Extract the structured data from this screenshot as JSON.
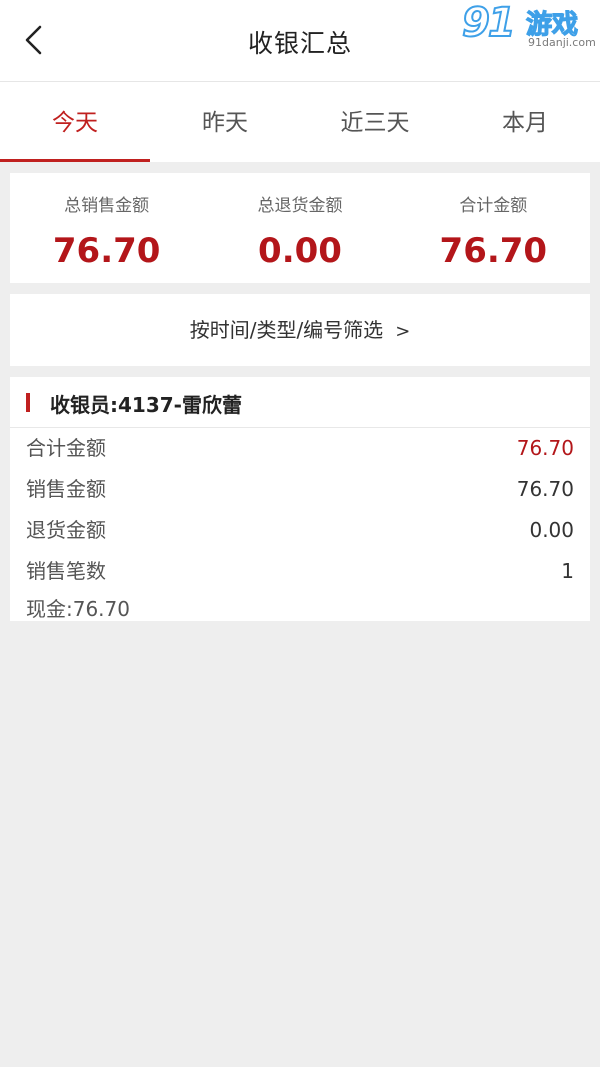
{
  "header": {
    "title": "收银汇总"
  },
  "watermark": {
    "brand_num": "91",
    "brand_text": "游戏",
    "url": "91danji.com"
  },
  "tabs": [
    {
      "label": "今天",
      "active": true
    },
    {
      "label": "昨天",
      "active": false
    },
    {
      "label": "近三天",
      "active": false
    },
    {
      "label": "本月",
      "active": false
    }
  ],
  "summary": [
    {
      "label": "总销售金额",
      "value": "76.70"
    },
    {
      "label": "总退货金额",
      "value": "0.00"
    },
    {
      "label": "合计金额",
      "value": "76.70"
    }
  ],
  "filter": {
    "label": "按时间/类型/编号筛选",
    "chevron": ">"
  },
  "cashier": {
    "title": "收银员:4137-雷欣蕾",
    "rows": [
      {
        "label": "合计金额",
        "value": "76.70"
      },
      {
        "label": "销售金额",
        "value": "76.70"
      },
      {
        "label": "退货金额",
        "value": "0.00"
      },
      {
        "label": "销售笔数",
        "value": "1"
      }
    ],
    "cash": "现金:76.70"
  },
  "colors": {
    "accent": "#c0201f",
    "amount": "#b3161a",
    "background": "#eeeeee"
  }
}
